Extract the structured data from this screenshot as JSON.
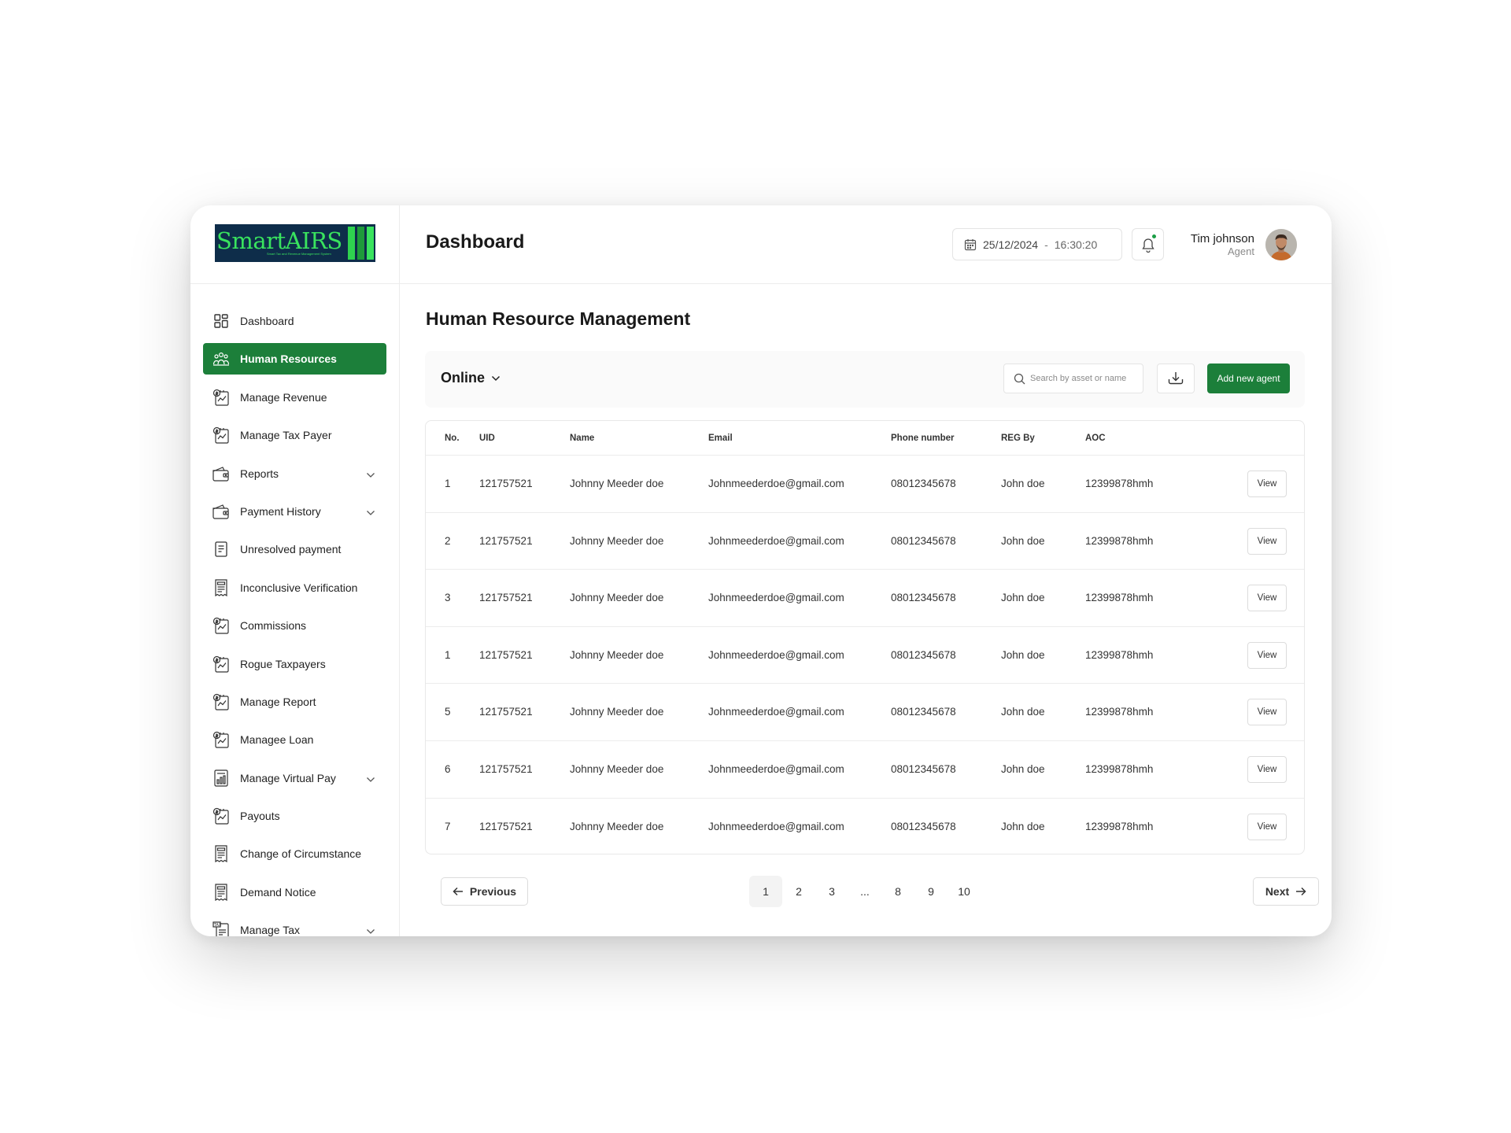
{
  "logo": {
    "text": "SmartAIRS",
    "tagline": "Smart Tax and Revenue Management System"
  },
  "header": {
    "title": "Dashboard",
    "date": "25/12/2024",
    "separator": "-",
    "time": "16:30:20",
    "user_name": "Tim johnson",
    "user_role": "Agent"
  },
  "sidebar": {
    "items": [
      {
        "label": "Dashboard",
        "icon": "grid-icon",
        "active": false,
        "chevron": false
      },
      {
        "label": "Human Resources",
        "icon": "people-icon",
        "active": true,
        "chevron": false
      },
      {
        "label": "Manage Revenue",
        "icon": "chart-doc-icon",
        "active": false,
        "chevron": false
      },
      {
        "label": "Manage Tax Payer",
        "icon": "chart-doc-icon",
        "active": false,
        "chevron": false
      },
      {
        "label": "Reports",
        "icon": "wallet-icon",
        "active": false,
        "chevron": true
      },
      {
        "label": "Payment History",
        "icon": "wallet-icon",
        "active": false,
        "chevron": true
      },
      {
        "label": "Unresolved payment",
        "icon": "document-icon",
        "active": false,
        "chevron": false
      },
      {
        "label": "Inconclusive Verification",
        "icon": "receipt-icon",
        "active": false,
        "chevron": false
      },
      {
        "label": "Commissions",
        "icon": "chart-doc-icon",
        "active": false,
        "chevron": false
      },
      {
        "label": "Rogue Taxpayers",
        "icon": "chart-doc-icon",
        "active": false,
        "chevron": false
      },
      {
        "label": "Manage Report",
        "icon": "chart-doc-icon",
        "active": false,
        "chevron": false
      },
      {
        "label": "Managee Loan",
        "icon": "chart-doc-icon",
        "active": false,
        "chevron": false
      },
      {
        "label": "Manage Virtual Pay",
        "icon": "receipt-chart-icon",
        "active": false,
        "chevron": true
      },
      {
        "label": "Payouts",
        "icon": "chart-doc-icon",
        "active": false,
        "chevron": false
      },
      {
        "label": "Change of Circumstance",
        "icon": "receipt-icon",
        "active": false,
        "chevron": false
      },
      {
        "label": "Demand Notice",
        "icon": "receipt-icon",
        "active": false,
        "chevron": false
      },
      {
        "label": "Manage Tax",
        "icon": "tax-doc-icon",
        "active": false,
        "chevron": true
      }
    ]
  },
  "main": {
    "section_title": "Human Resource Management",
    "filter_label": "Online",
    "search_placeholder": "Search by asset or name",
    "add_button": "Add new agent",
    "columns": [
      "No.",
      "UID",
      "Name",
      "Email",
      "Phone number",
      "REG By",
      "AOC"
    ],
    "view_label": "View",
    "rows": [
      {
        "no": "1",
        "uid": "121757521",
        "name": "Johnny Meeder doe",
        "email": "Johnmeederdoe@gmail.com",
        "phone": "08012345678",
        "reg": "John doe",
        "aoc": "12399878hmh"
      },
      {
        "no": "2",
        "uid": "121757521",
        "name": "Johnny Meeder doe",
        "email": "Johnmeederdoe@gmail.com",
        "phone": "08012345678",
        "reg": "John doe",
        "aoc": "12399878hmh"
      },
      {
        "no": "3",
        "uid": "121757521",
        "name": "Johnny Meeder doe",
        "email": "Johnmeederdoe@gmail.com",
        "phone": "08012345678",
        "reg": "John doe",
        "aoc": "12399878hmh"
      },
      {
        "no": "1",
        "uid": "121757521",
        "name": "Johnny Meeder doe",
        "email": "Johnmeederdoe@gmail.com",
        "phone": "08012345678",
        "reg": "John doe",
        "aoc": "12399878hmh"
      },
      {
        "no": "5",
        "uid": "121757521",
        "name": "Johnny Meeder doe",
        "email": "Johnmeederdoe@gmail.com",
        "phone": "08012345678",
        "reg": "John doe",
        "aoc": "12399878hmh"
      },
      {
        "no": "6",
        "uid": "121757521",
        "name": "Johnny Meeder doe",
        "email": "Johnmeederdoe@gmail.com",
        "phone": "08012345678",
        "reg": "John doe",
        "aoc": "12399878hmh"
      },
      {
        "no": "7",
        "uid": "121757521",
        "name": "Johnny Meeder doe",
        "email": "Johnmeederdoe@gmail.com",
        "phone": "08012345678",
        "reg": "John doe",
        "aoc": "12399878hmh"
      }
    ],
    "pagination": {
      "previous": "Previous",
      "next": "Next",
      "pages": [
        "1",
        "2",
        "3",
        "...",
        "8",
        "9",
        "10"
      ],
      "current": "1"
    }
  },
  "colors": {
    "accent": "#1c7f3a",
    "notification_dot": "#1c9e46",
    "logo_bg": "#0e2d4a",
    "logo_text": "#39e35e"
  }
}
